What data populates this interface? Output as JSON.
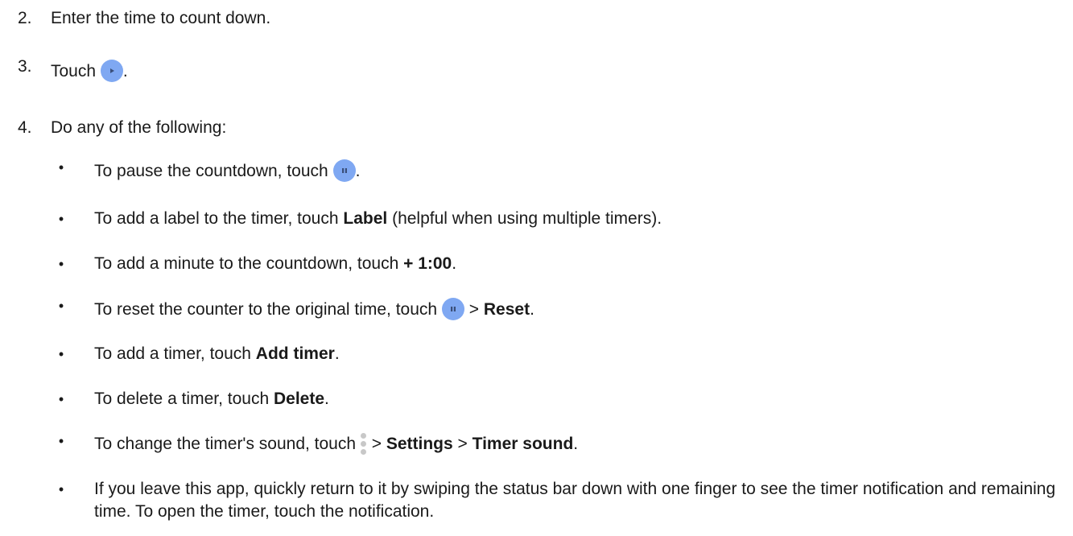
{
  "steps": [
    {
      "number": "2.",
      "text": "Enter the time to count down."
    },
    {
      "number": "3.",
      "text_before": "Touch",
      "text_after": ".",
      "icon": "play-icon"
    },
    {
      "number": "4.",
      "text": "Do any of the following:"
    }
  ],
  "bullets": {
    "pause": {
      "text_before": "To pause the countdown, touch",
      "text_after": ".",
      "icon": "pause-icon"
    },
    "label": {
      "text_before": "To add a label to the timer, touch",
      "bold": "Label",
      "text_after": "(helpful when using multiple timers)."
    },
    "minute": {
      "text_before": "To add a minute to the countdown, touch",
      "bold": "+ 1:00",
      "text_after": "."
    },
    "reset": {
      "text_before": "To reset the counter to the original time, touch",
      "separator": ">",
      "bold": "Reset",
      "text_after": ".",
      "icon": "pause-icon"
    },
    "add_timer": {
      "text_before": "To add a timer, touch",
      "bold": "Add timer",
      "text_after": "."
    },
    "delete": {
      "text_before": "To delete a timer, touch",
      "bold": "Delete",
      "text_after": "."
    },
    "sound": {
      "text_before": "To change the timer's sound, touch",
      "separator1": ">",
      "bold1": "Settings",
      "separator2": ">",
      "bold2": "Timer sound",
      "text_after": ".",
      "icon": "more-vert-icon"
    },
    "leave": {
      "text": "If you leave this app, quickly return to it by swiping the status bar down with one finger to see the timer notification and remaining time. To open the timer, touch the notification."
    }
  },
  "colors": {
    "icon_button": "#7fa8f2",
    "text": "#1a1a1a"
  }
}
